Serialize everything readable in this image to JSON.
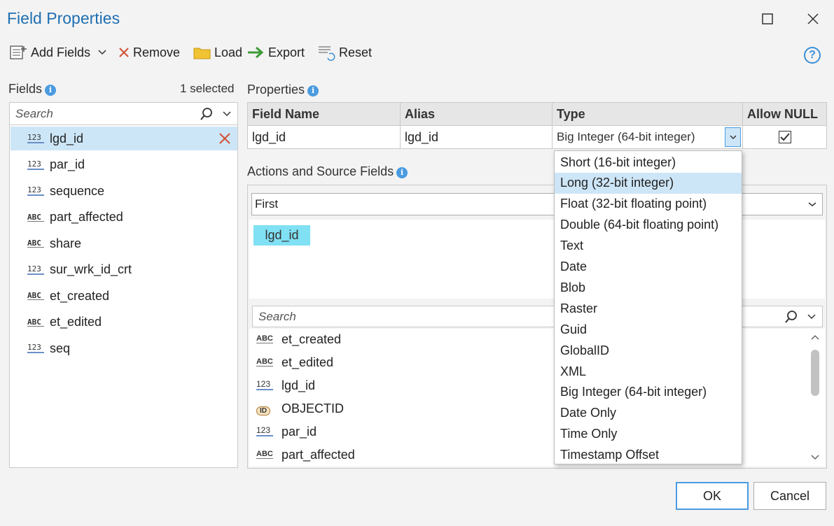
{
  "window": {
    "title": "Field Properties"
  },
  "toolbar": {
    "add_fields": "Add Fields",
    "remove": "Remove",
    "load": "Load",
    "export": "Export",
    "reset": "Reset",
    "help": "?"
  },
  "fields_panel": {
    "label": "Fields",
    "selected_count": "1 selected",
    "search_placeholder": "Search",
    "items": [
      {
        "name": "lgd_id",
        "type": "number",
        "selected": true
      },
      {
        "name": "par_id",
        "type": "number"
      },
      {
        "name": "sequence",
        "type": "number"
      },
      {
        "name": "part_affected",
        "type": "text"
      },
      {
        "name": "share",
        "type": "text"
      },
      {
        "name": "sur_wrk_id_crt",
        "type": "number"
      },
      {
        "name": "et_created",
        "type": "text"
      },
      {
        "name": "et_edited",
        "type": "text"
      },
      {
        "name": "seq",
        "type": "number"
      }
    ]
  },
  "properties": {
    "label": "Properties",
    "columns": {
      "field_name": "Field Name",
      "alias": "Alias",
      "type": "Type",
      "allow_null": "Allow NULL"
    },
    "row": {
      "field_name": "lgd_id",
      "alias": "lgd_id",
      "type": "Big Integer (64-bit integer)",
      "allow_null": true
    }
  },
  "type_dropdown": {
    "options": [
      "Short (16-bit integer)",
      "Long (32-bit integer)",
      "Float (32-bit floating point)",
      "Double (64-bit floating point)",
      "Text",
      "Date",
      "Blob",
      "Raster",
      "Guid",
      "GlobalID",
      "XML",
      "Big Integer (64-bit integer)",
      "Date Only",
      "Time Only",
      "Timestamp Offset"
    ],
    "highlighted": "Long (32-bit integer)"
  },
  "actions": {
    "label": "Actions and Source Fields",
    "action_value": "First",
    "source_chip": "lgd_id",
    "search_placeholder": "Search",
    "source_fields": [
      {
        "name": "et_created",
        "type": "text"
      },
      {
        "name": "et_edited",
        "type": "text"
      },
      {
        "name": "lgd_id",
        "type": "number"
      },
      {
        "name": "OBJECTID",
        "type": "oid"
      },
      {
        "name": "par_id",
        "type": "number"
      },
      {
        "name": "part_affected",
        "type": "text"
      }
    ]
  },
  "icon_glyphs": {
    "number": "123",
    "text": "ABC",
    "oid": "ID"
  },
  "buttons": {
    "ok": "OK",
    "cancel": "Cancel"
  },
  "colors": {
    "title": "#1f6fb2",
    "selection": "#cde6f7",
    "chip": "#80e0f4",
    "remove_x": "#d0553a"
  }
}
